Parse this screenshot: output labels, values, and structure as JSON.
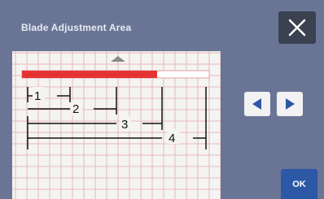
{
  "window": {
    "title": "Blade Adjustment Area"
  },
  "buttons": {
    "close_icon": "close-icon",
    "ok_label": "OK"
  },
  "navigation": {
    "left_icon": "left-arrow-icon",
    "right_icon": "right-arrow-icon"
  },
  "scroll_indicator": {
    "icon": "up-arrow-icon"
  },
  "progress_bar": {
    "fill_fraction": 0.72,
    "color": "#e53333"
  },
  "markers": [
    "1",
    "2",
    "3",
    "4"
  ],
  "colors": {
    "background": "#6a7596",
    "grid": "#e7b9b9",
    "accent": "#2c58a6"
  }
}
